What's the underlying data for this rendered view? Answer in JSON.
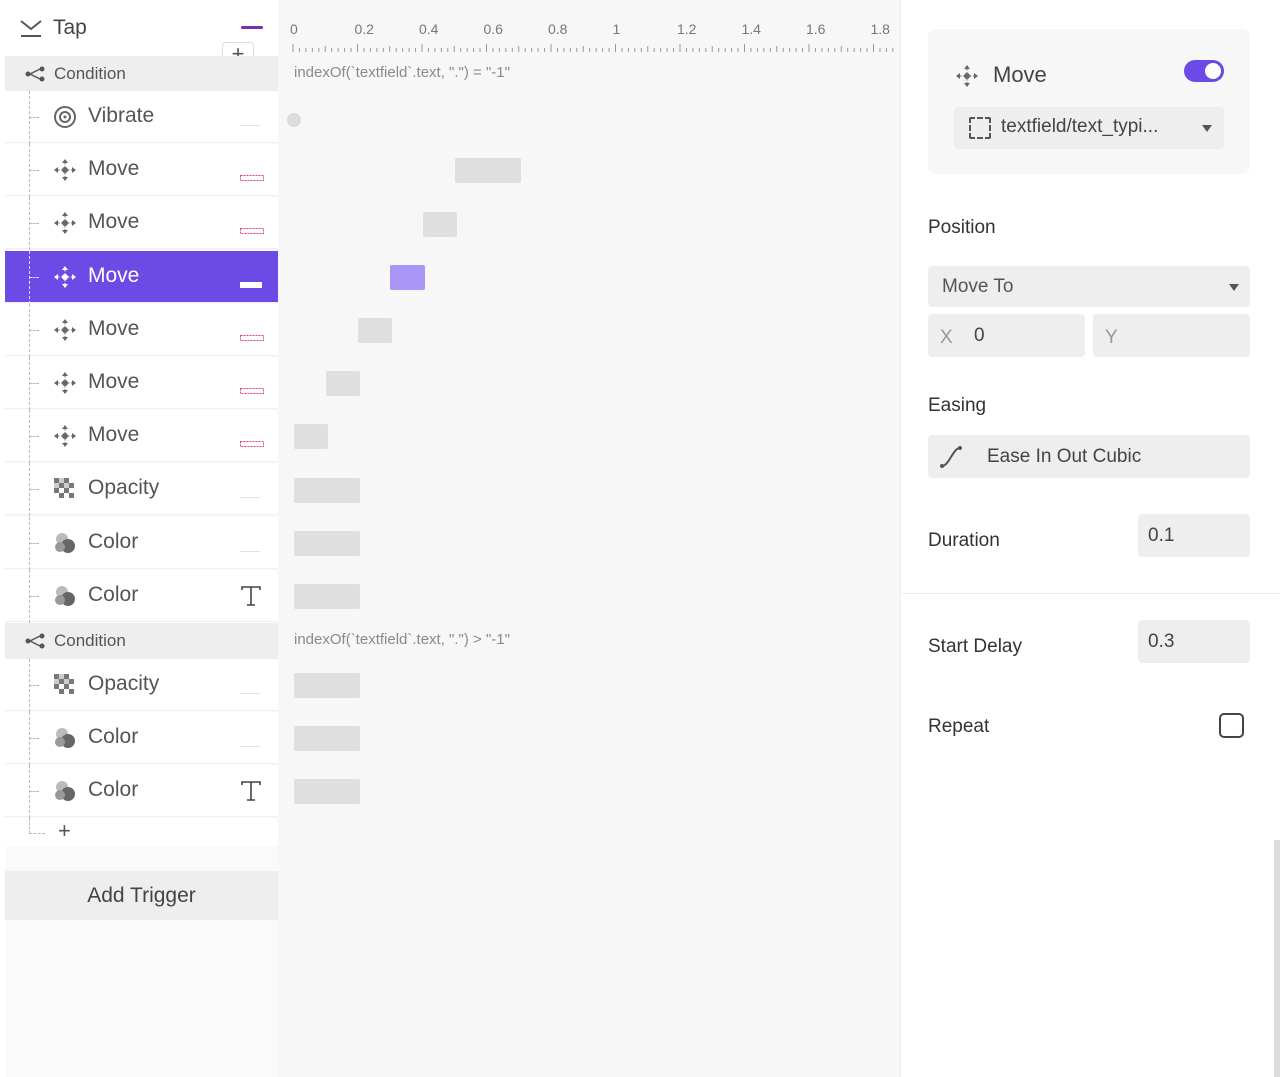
{
  "trigger": {
    "label": "Tap",
    "accent": "#7b2fa8"
  },
  "tree": {
    "condition_label": "Condition",
    "items_a": [
      {
        "label": "Vibrate",
        "icon": "vibrate-icon"
      },
      {
        "label": "Move",
        "icon": "move-icon",
        "mark": "dashed-bar"
      },
      {
        "label": "Move",
        "icon": "move-icon",
        "mark": "dashed-bar"
      },
      {
        "label": "Move",
        "icon": "move-icon",
        "mark": "dashed-bar",
        "selected": true
      },
      {
        "label": "Move",
        "icon": "move-icon",
        "mark": "dashed-bar"
      },
      {
        "label": "Move",
        "icon": "move-icon",
        "mark": "dashed-bar"
      },
      {
        "label": "Move",
        "icon": "move-icon",
        "mark": "dashed-bar"
      },
      {
        "label": "Opacity",
        "icon": "opacity-icon"
      },
      {
        "label": "Color",
        "icon": "color-icon"
      },
      {
        "label": "Color",
        "icon": "color-icon",
        "mark": "T"
      }
    ],
    "items_b": [
      {
        "label": "Opacity",
        "icon": "opacity-icon"
      },
      {
        "label": "Color",
        "icon": "color-icon"
      },
      {
        "label": "Color",
        "icon": "color-icon",
        "mark": "T"
      }
    ],
    "add_trigger_label": "Add Trigger",
    "add_symbol": "+",
    "selection_color": "#6b4ae6"
  },
  "timeline": {
    "ticks": [
      "0",
      "0.2",
      "0.4",
      "0.6",
      "0.8",
      "1",
      "1.2",
      "1.4",
      "1.6",
      "1.8"
    ],
    "condition_a_expr": "indexOf(`textfield`.text, \".\") = \"-1\"",
    "condition_b_expr": "indexOf(`textfield`.text, \".\") > \"-1\""
  },
  "inspector": {
    "title": "Move",
    "enabled": true,
    "target": "textfield/text_typi...",
    "position_label": "Position",
    "position_mode": "Move To",
    "x_label": "X",
    "x_value": "0",
    "y_label": "Y",
    "y_value": "",
    "easing_label": "Easing",
    "easing_value": "Ease In Out Cubic",
    "duration_label": "Duration",
    "duration_value": "0.1",
    "start_delay_label": "Start Delay",
    "start_delay_value": "0.3",
    "repeat_label": "Repeat",
    "repeat_checked": false,
    "accent": "#6b4ae6"
  }
}
